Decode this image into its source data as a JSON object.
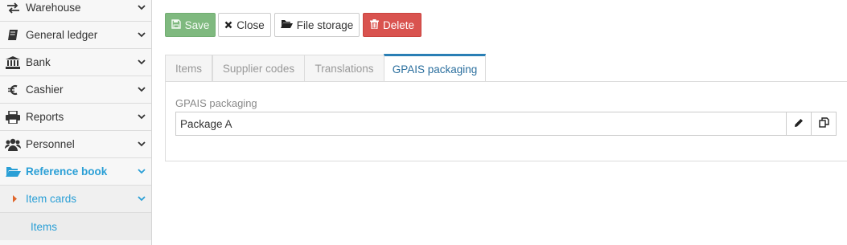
{
  "sidebar": {
    "items": [
      {
        "label": "Warehouse",
        "icon": "exchange-icon"
      },
      {
        "label": "General ledger",
        "icon": "book-icon"
      },
      {
        "label": "Bank",
        "icon": "bank-icon"
      },
      {
        "label": "Cashier",
        "icon": "euro-icon"
      },
      {
        "label": "Reports",
        "icon": "print-icon"
      },
      {
        "label": "Personnel",
        "icon": "users-icon"
      },
      {
        "label": "Reference book",
        "icon": "folder-open-icon"
      }
    ],
    "sub_item": {
      "label": "Item cards",
      "icon": "caret-right-icon"
    },
    "sub_sub_item": {
      "label": "Items"
    }
  },
  "toolbar": {
    "save_label": "Save",
    "close_label": "Close",
    "file_storage_label": "File storage",
    "delete_label": "Delete"
  },
  "tabs": [
    {
      "label": "Items"
    },
    {
      "label": "Supplier codes"
    },
    {
      "label": "Translations"
    },
    {
      "label": "GPAIS packaging"
    }
  ],
  "form": {
    "gpais_label": "GPAIS packaging",
    "gpais_value": "Package A"
  },
  "colors": {
    "accent": "#2a9fd6",
    "save": "#7fb97f",
    "delete": "#d9534f",
    "active_tab_border": "#2a7fb5"
  }
}
